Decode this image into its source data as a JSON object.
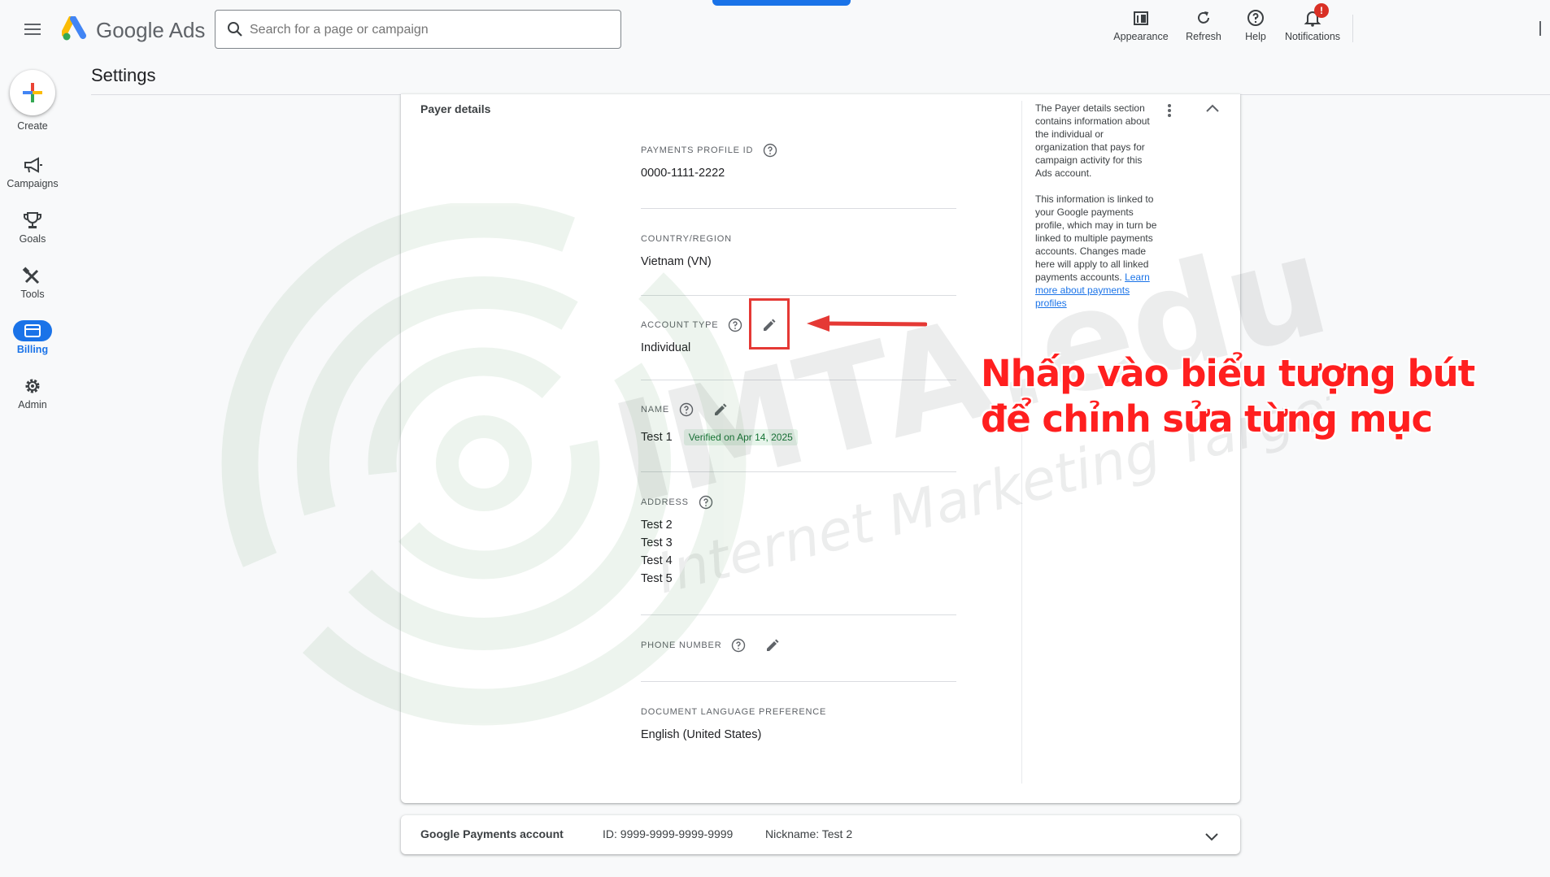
{
  "header": {
    "brand": "Google Ads",
    "search_placeholder": "Search for a page or campaign",
    "tools": [
      {
        "label": "Appearance",
        "icon": "appearance-icon"
      },
      {
        "label": "Refresh",
        "icon": "refresh-icon"
      },
      {
        "label": "Help",
        "icon": "help-icon"
      },
      {
        "label": "Notifications",
        "icon": "bell-icon",
        "badge": "!"
      }
    ]
  },
  "nav": {
    "create": "Create",
    "items": [
      {
        "label": "Campaigns",
        "icon": "megaphone-icon"
      },
      {
        "label": "Goals",
        "icon": "trophy-icon"
      },
      {
        "label": "Tools",
        "icon": "tools-icon"
      },
      {
        "label": "Billing",
        "icon": "billing-icon",
        "active": true
      },
      {
        "label": "Admin",
        "icon": "gear-icon"
      }
    ]
  },
  "page": {
    "title": "Settings"
  },
  "payer": {
    "section_title": "Payer details",
    "fields": {
      "profile_id": {
        "label": "PAYMENTS PROFILE ID",
        "value": "0000-1111-2222"
      },
      "country": {
        "label": "COUNTRY/REGION",
        "value": "Vietnam (VN)"
      },
      "account_type": {
        "label": "ACCOUNT TYPE",
        "value": "Individual"
      },
      "name": {
        "label": "NAME",
        "value": "Test 1",
        "badge": "Verified on Apr 14, 2025"
      },
      "address": {
        "label": "ADDRESS",
        "lines": [
          "Test 2",
          "Test 3",
          "Test 4",
          "Test 5"
        ]
      },
      "phone": {
        "label": "PHONE NUMBER"
      },
      "doc_language": {
        "label": "DOCUMENT LANGUAGE PREFERENCE",
        "value": "English (United States)"
      }
    },
    "help": {
      "p1": "The Payer details section contains information about the individual or organization that pays for campaign activity for this Ads account.",
      "p2": "This information is linked to your Google payments profile, which may in turn be linked to multiple payments accounts. Changes made here will apply to all linked payments accounts.",
      "link": "Learn more about payments profiles"
    }
  },
  "payments_account": {
    "title": "Google Payments account",
    "id": "ID: 9999-9999-9999-9999",
    "nickname": "Nickname: Test 2"
  },
  "annotation": {
    "line1": "Nhấp vào biểu tượng bút",
    "line2": "để chỉnh sửa từng mục"
  },
  "watermark": {
    "main": "IMTA.edu.vn",
    "sub": "Internet Marketing Target Ads"
  },
  "colors": {
    "accent": "#1a73e8",
    "annotation_red": "#ff1f1f",
    "verified_green": "#137333"
  }
}
